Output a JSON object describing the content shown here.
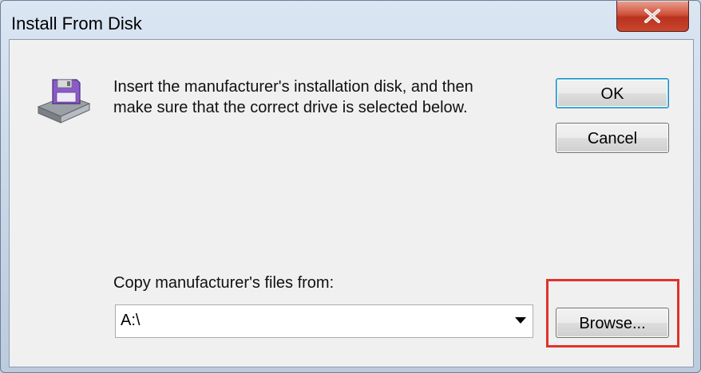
{
  "window": {
    "title": "Install From Disk",
    "close_icon": "close-icon"
  },
  "message": {
    "icon": "disk-drive-icon",
    "line1": "Insert the manufacturer's installation disk, and then",
    "line2": "make sure that the correct drive is selected below."
  },
  "buttons": {
    "ok_label": "OK",
    "cancel_label": "Cancel",
    "browse_label": "Browse..."
  },
  "copy_from": {
    "label": "Copy manufacturer's files from:",
    "value": "A:\\"
  },
  "colors": {
    "highlight": "#e0332a",
    "close_button": "#c9462c"
  }
}
